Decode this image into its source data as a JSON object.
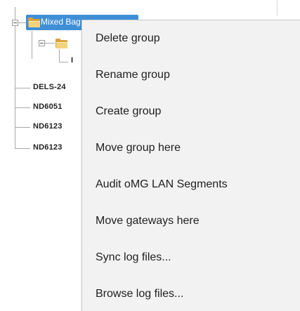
{
  "tree": {
    "selected_group": {
      "label": "Mixed Bag"
    },
    "devices": [
      {
        "label": "DELS-24"
      },
      {
        "label": "ND6051"
      },
      {
        "label": "ND6123"
      },
      {
        "label": "ND6123"
      }
    ],
    "partial_child_label": "I"
  },
  "context_menu": {
    "items": [
      {
        "label": "Delete group"
      },
      {
        "label": "Rename group"
      },
      {
        "label": "Create group"
      },
      {
        "label": "Move group here"
      },
      {
        "label": "Audit oMG LAN Segments"
      },
      {
        "label": "Move gateways here"
      },
      {
        "label": "Sync log files..."
      },
      {
        "label": "Browse log files..."
      }
    ]
  },
  "colors": {
    "selection_blue": "#3f8fd6",
    "menu_background": "#f2f2f2",
    "folder_gold": "#d9a33a"
  }
}
